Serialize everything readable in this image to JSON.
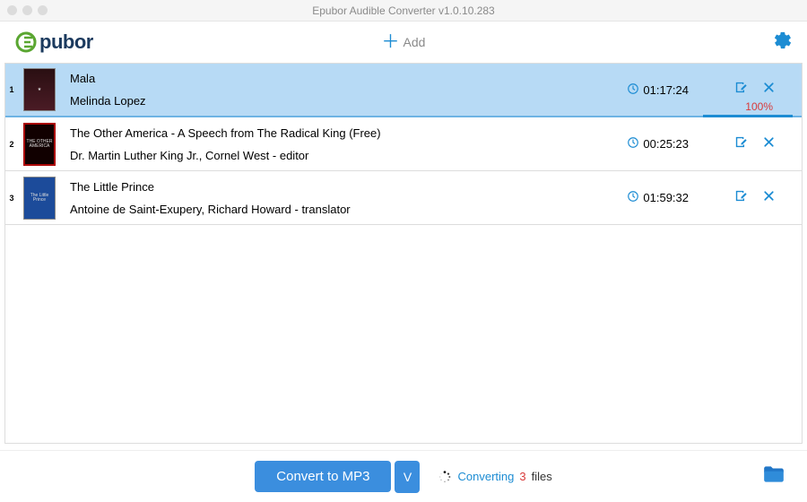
{
  "window": {
    "title": "Epubor Audible Converter v1.0.10.283"
  },
  "brand": {
    "text": "pubor"
  },
  "toolbar": {
    "add_label": "Add"
  },
  "items": [
    {
      "num": "1",
      "title": "Mala",
      "author": "Melinda Lopez",
      "duration": "01:17:24",
      "selected": true,
      "progress": "100%"
    },
    {
      "num": "2",
      "title": "The Other America - A Speech from The Radical King (Free)",
      "author": "Dr. Martin Luther King Jr., Cornel West - editor",
      "duration": "00:25:23",
      "selected": false
    },
    {
      "num": "3",
      "title": "The Little Prince",
      "author": "Antoine de Saint-Exupery, Richard Howard - translator",
      "duration": "01:59:32",
      "selected": false
    }
  ],
  "footer": {
    "convert_label": "Convert to MP3",
    "dropdown_label": "V",
    "status_word": "Converting",
    "status_count": "3",
    "status_files": "files"
  }
}
